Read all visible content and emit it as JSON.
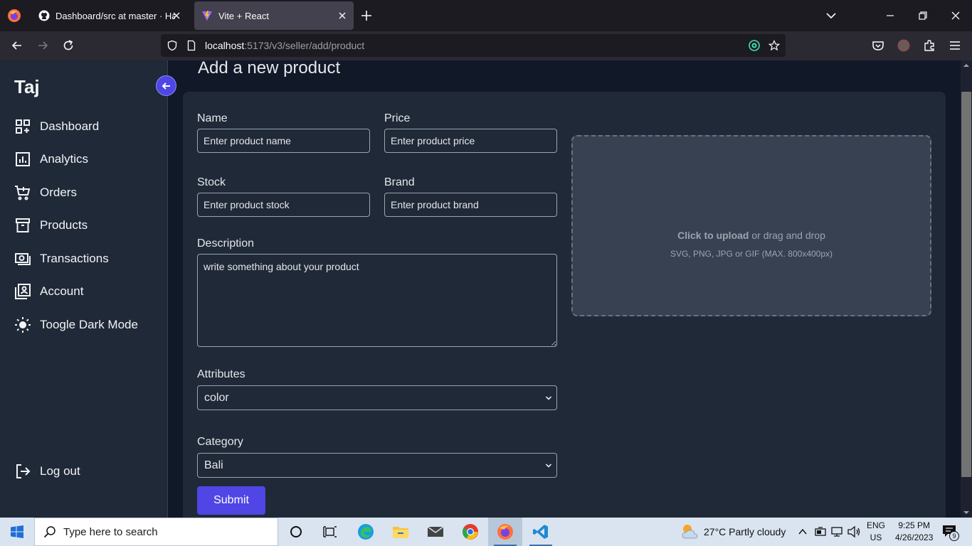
{
  "browser": {
    "tabs": [
      {
        "title": "Dashboard/src at master · Hayat"
      },
      {
        "title": "Vite + React"
      }
    ],
    "url_host": "localhost",
    "url_path": ":5173/v3/seller/add/product"
  },
  "sidebar": {
    "brand": "Taj",
    "items": [
      {
        "label": "Dashboard",
        "icon": "dashboard-grid-icon"
      },
      {
        "label": "Analytics",
        "icon": "analytics-chart-icon"
      },
      {
        "label": "Orders",
        "icon": "cart-icon"
      },
      {
        "label": "Products",
        "icon": "archive-box-icon"
      },
      {
        "label": "Transactions",
        "icon": "cash-icon"
      },
      {
        "label": "Account",
        "icon": "account-card-icon"
      },
      {
        "label": "Toogle Dark Mode",
        "icon": "sun-icon"
      }
    ],
    "logout": "Log out"
  },
  "main": {
    "title": "Add a new product",
    "form": {
      "name_label": "Name",
      "name_placeholder": "Enter product name",
      "price_label": "Price",
      "price_placeholder": "Enter product price",
      "stock_label": "Stock",
      "stock_placeholder": "Enter product stock",
      "brand_label": "Brand",
      "brand_placeholder": "Enter product brand",
      "description_label": "Description",
      "description_placeholder": "write something about your product",
      "attributes_label": "Attributes",
      "attributes_value": "color",
      "category_label": "Category",
      "category_value": "Bali",
      "submit_label": "Submit"
    },
    "upload": {
      "click_text": "Click to upload",
      "rest_text": " or drag and drop",
      "hint": "SVG, PNG, JPG or GIF (MAX. 800x400px)"
    }
  },
  "taskbar": {
    "search_placeholder": "Type here to search",
    "weather": "27°C  Partly cloudy",
    "lang_top": "ENG",
    "lang_bottom": "US",
    "time": "9:25 PM",
    "date": "4/26/2023",
    "notification_count": "9"
  }
}
